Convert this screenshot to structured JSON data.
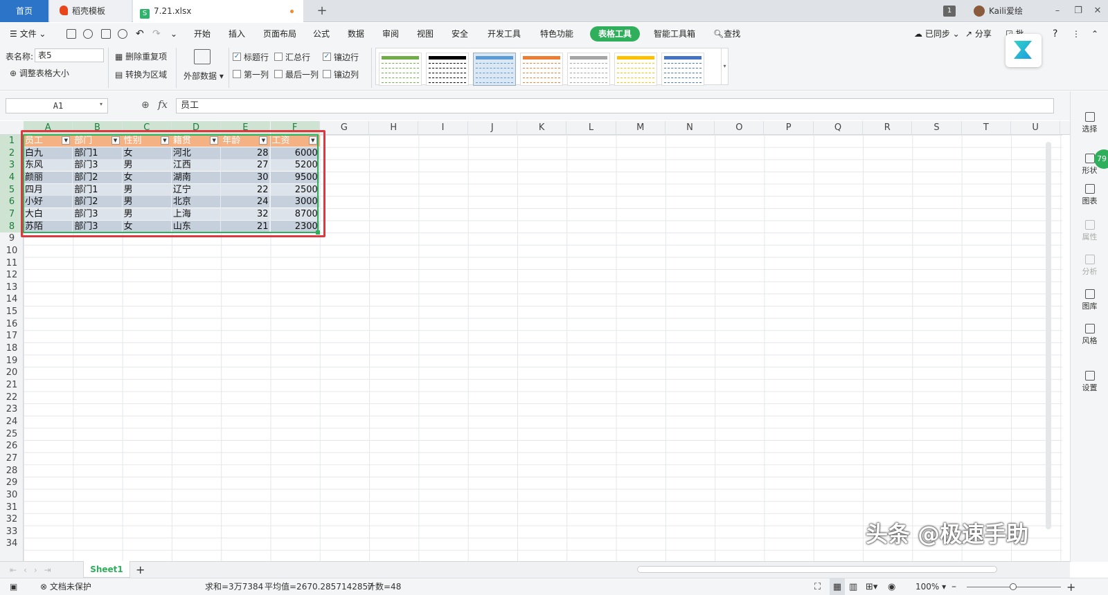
{
  "tabs": {
    "home": "首页",
    "docer": "稻壳模板",
    "file": "7.21.xlsx",
    "add": "+"
  },
  "titlebar": {
    "count": "1",
    "user": "Kaili爱绘",
    "minimize": "–",
    "restore": "❐",
    "close": "✕"
  },
  "menu": {
    "file": "文件",
    "items": [
      "开始",
      "插入",
      "页面布局",
      "公式",
      "数据",
      "审阅",
      "视图",
      "安全",
      "开发工具",
      "特色功能"
    ],
    "active": "表格工具",
    "after": [
      "智能工具箱"
    ],
    "search": "查找",
    "sync": "已同步",
    "share": "分享",
    "batch": "批"
  },
  "ribbon": {
    "table_name_label": "表名称:",
    "table_name": "表5",
    "resize": "调整表格大小",
    "remove_dup": "删除重复项",
    "convert": "转换为区域",
    "external": "外部数据",
    "checks": [
      {
        "label": "标题行",
        "checked": true
      },
      {
        "label": "汇总行",
        "checked": false
      },
      {
        "label": "镶边行",
        "checked": true
      },
      {
        "label": "第一列",
        "checked": false
      },
      {
        "label": "最后一列",
        "checked": false
      },
      {
        "label": "镶边列",
        "checked": false
      }
    ],
    "style_colors": [
      "#70ad47",
      "#000000",
      "#5b9bd5",
      "#ed7d31",
      "#a5a5a5",
      "#ffc000",
      "#4472c4"
    ]
  },
  "formula": {
    "cell_ref": "A1",
    "fx": "fx",
    "value": "员工"
  },
  "sheet": {
    "columns": [
      "A",
      "B",
      "C",
      "D",
      "E",
      "F",
      "G",
      "H",
      "I",
      "J",
      "K",
      "L",
      "M",
      "N",
      "O",
      "P",
      "Q",
      "R",
      "S",
      "T",
      "U"
    ],
    "rows": [
      "1",
      "2",
      "3",
      "4",
      "5",
      "6",
      "7",
      "8",
      "9",
      "10",
      "11",
      "12",
      "13",
      "14",
      "15",
      "16",
      "17",
      "18",
      "19",
      "20",
      "21",
      "22",
      "23",
      "24",
      "25",
      "26",
      "27",
      "28",
      "29",
      "30",
      "31",
      "32",
      "33",
      "34"
    ],
    "headers": [
      "员工",
      "部门",
      "性别",
      "籍贯",
      "年龄",
      "工资"
    ],
    "data": [
      [
        "白九",
        "部门1",
        "女",
        "河北",
        "28",
        "6000"
      ],
      [
        "东风",
        "部门3",
        "男",
        "江西",
        "27",
        "5200"
      ],
      [
        "颜丽",
        "部门2",
        "女",
        "湖南",
        "30",
        "9500"
      ],
      [
        "四月",
        "部门1",
        "男",
        "辽宁",
        "22",
        "2500"
      ],
      [
        "小好",
        "部门2",
        "男",
        "北京",
        "24",
        "3000"
      ],
      [
        "大白",
        "部门3",
        "男",
        "上海",
        "32",
        "8700"
      ],
      [
        "苏陌",
        "部门3",
        "女",
        "山东",
        "21",
        "2300"
      ]
    ],
    "header_color": "#f4b183",
    "band_color": "#c5d0dc",
    "band_alt": "#dde3ea"
  },
  "sidebar": [
    {
      "label": "选择",
      "dim": false
    },
    {
      "label": "形状",
      "dim": false
    },
    {
      "label": "图表",
      "dim": false
    },
    {
      "label": "属性",
      "dim": true
    },
    {
      "label": "分析",
      "dim": true
    },
    {
      "label": "图库",
      "dim": false
    },
    {
      "label": "风格",
      "dim": false
    },
    {
      "label": "设置",
      "dim": false
    }
  ],
  "badge": "79",
  "sheettabs": {
    "active": "Sheet1",
    "add": "+"
  },
  "status": {
    "protect": "文档未保护",
    "sum": "求和=3万7384",
    "avg": "平均值=2670.2857142857",
    "count": "计数=48",
    "zoom": "100%",
    "minus": "–",
    "plus": "+"
  },
  "watermark": "头条 @极速手助"
}
